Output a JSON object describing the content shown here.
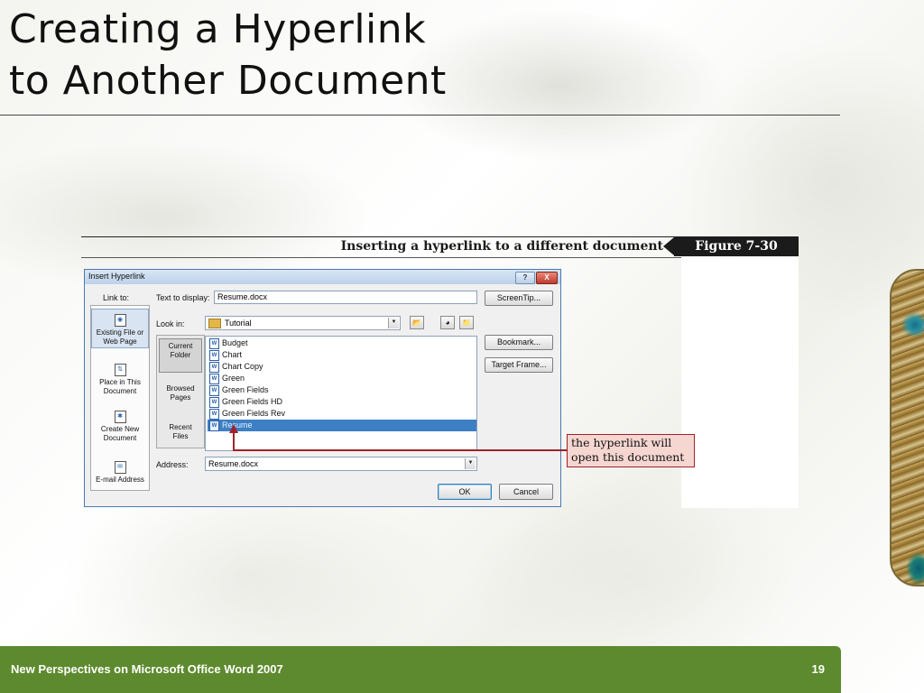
{
  "slide": {
    "title_line1": "Creating a Hyperlink",
    "title_line2": "to Another Document",
    "footer_text": "New Perspectives on Microsoft Office Word 2007",
    "page_number": "19",
    "footer_color": "#5d8a2e"
  },
  "figure": {
    "caption": "Inserting a hyperlink to a different document",
    "label": "Figure 7-30",
    "callout": [
      "the hyperlink will",
      "open this document"
    ],
    "callout_color": "#a1222b"
  },
  "dialog": {
    "title": "Insert Hyperlink",
    "help_button": "?",
    "close_button": "X",
    "link_to_label": "Link to:",
    "text_to_display_label": "Text to display:",
    "text_to_display_value": "Resume.docx",
    "screentip_button": "ScreenTip...",
    "look_in_label": "Look in:",
    "look_in_value": "Tutorial",
    "bookmark_button": "Bookmark...",
    "target_frame_button": "Target Frame...",
    "address_label": "Address:",
    "address_value": "Resume.docx",
    "ok_button": "OK",
    "cancel_button": "Cancel",
    "link_to_items": [
      {
        "label_line1": "Existing File or",
        "label_line2": "Web Page",
        "icon": "existing-file-icon",
        "selected": true
      },
      {
        "label_line1": "Place in This",
        "label_line2": "Document",
        "icon": "place-in-document-icon",
        "selected": false
      },
      {
        "label_line1": "Create New",
        "label_line2": "Document",
        "icon": "new-document-icon",
        "selected": false
      },
      {
        "label_line1": "E-mail Address",
        "label_line2": "",
        "icon": "email-icon",
        "selected": false
      }
    ],
    "look_in_items": [
      {
        "label_line1": "Current",
        "label_line2": "Folder",
        "selected": true
      },
      {
        "label_line1": "Browsed",
        "label_line2": "Pages",
        "selected": false
      },
      {
        "label_line1": "Recent",
        "label_line2": "Files",
        "selected": false
      }
    ],
    "files": [
      {
        "name": "Budget",
        "selected": false
      },
      {
        "name": "Chart",
        "selected": false
      },
      {
        "name": "Chart Copy",
        "selected": false
      },
      {
        "name": "Green",
        "selected": false
      },
      {
        "name": "Green Fields",
        "selected": false
      },
      {
        "name": "Green Fields HD",
        "selected": false
      },
      {
        "name": "Green Fields Rev",
        "selected": false
      },
      {
        "name": "Resume",
        "selected": true
      }
    ]
  }
}
